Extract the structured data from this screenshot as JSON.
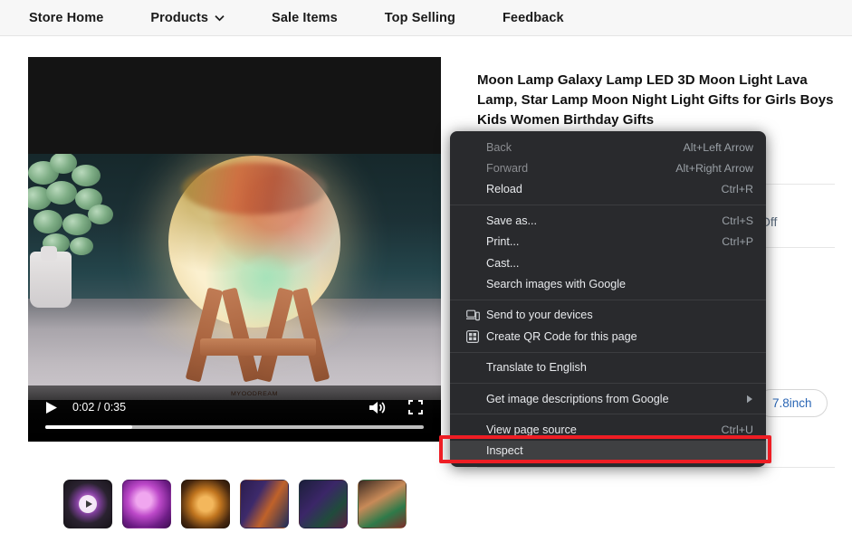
{
  "navbar": {
    "items": [
      {
        "label": "Store Home",
        "has_caret": false,
        "icon": ""
      },
      {
        "label": "Products",
        "has_caret": true,
        "icon": "chevron-down-icon"
      },
      {
        "label": "Sale Items",
        "has_caret": false,
        "icon": ""
      },
      {
        "label": "Top Selling",
        "has_caret": false,
        "icon": ""
      },
      {
        "label": "Feedback",
        "has_caret": false,
        "icon": ""
      }
    ]
  },
  "media": {
    "video": {
      "play_icon": "play-icon",
      "time_display": "0:02 / 0:35",
      "current_time": "0:02",
      "duration": "0:35",
      "progress_percent": 23,
      "volume_icon": "volume-icon",
      "fullscreen_icon": "fullscreen-icon",
      "alt": "Moon lamp galaxy light on wooden stand beside a green plant"
    },
    "thumbnails": [
      {
        "name": "thumb-video",
        "is_video": true,
        "selected": true
      },
      {
        "name": "thumb-purple-lamp",
        "is_video": false,
        "selected": false
      },
      {
        "name": "thumb-orange-moon",
        "is_video": false,
        "selected": false
      },
      {
        "name": "thumb-collage-blue",
        "is_video": false,
        "selected": false
      },
      {
        "name": "thumb-color-grid",
        "is_video": false,
        "selected": false
      },
      {
        "name": "thumb-kids-photo",
        "is_video": false,
        "selected": false
      }
    ]
  },
  "product": {
    "title": "Moon Lamp Galaxy Lamp LED 3D Moon Light Lava Lamp, Star Lamp Moon Night Light Gifts for Girls Boys Kids Women Birthday Gifts",
    "discount_text": "Off",
    "size_option": "7.8inch"
  },
  "context_menu": {
    "groups": [
      {
        "items": [
          {
            "label": "Back",
            "accel": "Alt+Left Arrow",
            "disabled": true,
            "icon": "",
            "submenu": false,
            "highlight": false
          },
          {
            "label": "Forward",
            "accel": "Alt+Right Arrow",
            "disabled": true,
            "icon": "",
            "submenu": false,
            "highlight": false
          },
          {
            "label": "Reload",
            "accel": "Ctrl+R",
            "disabled": false,
            "icon": "",
            "submenu": false,
            "highlight": false
          }
        ]
      },
      {
        "items": [
          {
            "label": "Save as...",
            "accel": "Ctrl+S",
            "disabled": false,
            "icon": "",
            "submenu": false,
            "highlight": false
          },
          {
            "label": "Print...",
            "accel": "Ctrl+P",
            "disabled": false,
            "icon": "",
            "submenu": false,
            "highlight": false
          },
          {
            "label": "Cast...",
            "accel": "",
            "disabled": false,
            "icon": "",
            "submenu": false,
            "highlight": false
          },
          {
            "label": "Search images with Google",
            "accel": "",
            "disabled": false,
            "icon": "",
            "submenu": false,
            "highlight": false
          }
        ]
      },
      {
        "items": [
          {
            "label": "Send to your devices",
            "accel": "",
            "disabled": false,
            "icon": "devices-icon",
            "submenu": false,
            "highlight": false
          },
          {
            "label": "Create QR Code for this page",
            "accel": "",
            "disabled": false,
            "icon": "qr-code-icon",
            "submenu": false,
            "highlight": false
          }
        ]
      },
      {
        "items": [
          {
            "label": "Translate to English",
            "accel": "",
            "disabled": false,
            "icon": "",
            "submenu": false,
            "highlight": false
          }
        ]
      },
      {
        "items": [
          {
            "label": "Get image descriptions from Google",
            "accel": "",
            "disabled": false,
            "icon": "",
            "submenu": true,
            "highlight": false
          }
        ]
      },
      {
        "items": [
          {
            "label": "View page source",
            "accel": "Ctrl+U",
            "disabled": false,
            "icon": "",
            "submenu": false,
            "highlight": false
          },
          {
            "label": "Inspect",
            "accel": "",
            "disabled": false,
            "icon": "",
            "submenu": false,
            "highlight": true
          }
        ]
      }
    ]
  },
  "annotation": {
    "highlight_color": "#ee1d24",
    "target_label": "Inspect"
  }
}
